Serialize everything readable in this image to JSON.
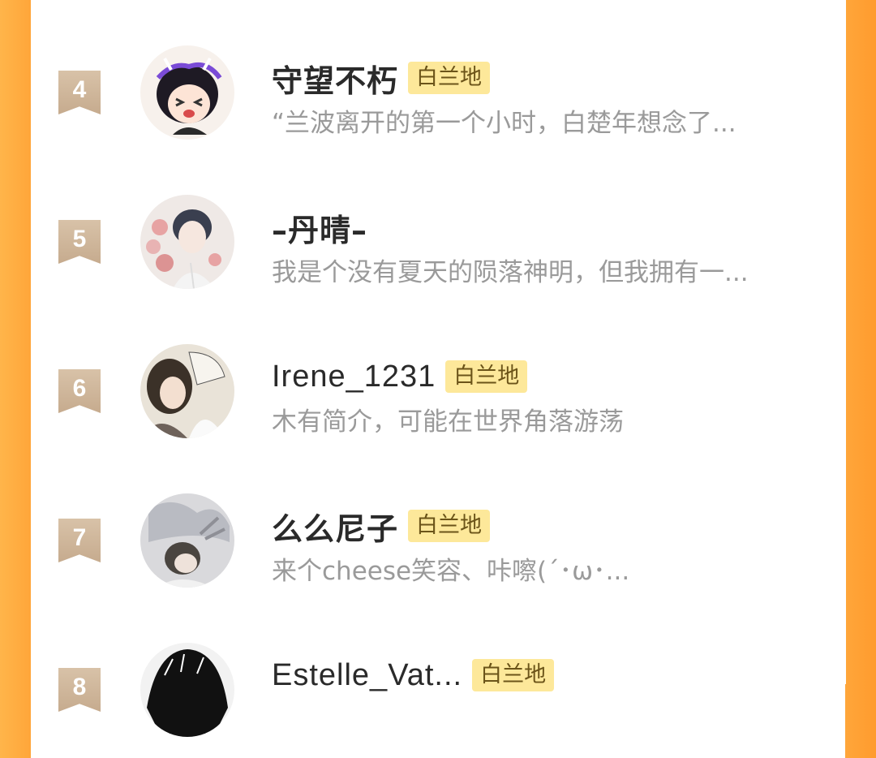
{
  "ranking_list": {
    "items": [
      {
        "rank": "4",
        "name": "守望不朽",
        "badge": "白兰地",
        "description": "“兰波离开的第一个小时，白楚年想念了...",
        "avatar_icon": "avatar-anime-boy-crying-icon"
      },
      {
        "rank": "5",
        "name": "–丹晴–",
        "badge": "",
        "description": "我是个没有夏天的陨落神明，但我拥有一...",
        "avatar_icon": "avatar-anime-man-flowers-icon"
      },
      {
        "rank": "6",
        "name": "Irene_1231",
        "badge": "白兰地",
        "description": "木有简介，可能在世界角落游荡",
        "avatar_icon": "avatar-anime-fan-couple-icon"
      },
      {
        "rank": "7",
        "name": "么么尼子",
        "badge": "白兰地",
        "description": "来个cheese笑容、咔嚓(´･ω･...",
        "avatar_icon": "avatar-anime-grey-couple-icon"
      },
      {
        "rank": "8",
        "name": "Estelle_Vat...",
        "badge": "白兰地",
        "description": "",
        "avatar_icon": "avatar-anime-dark-hair-icon"
      }
    ]
  },
  "colors": {
    "side_gradient": "#ffa63a",
    "rank_bookmark": "#c6ab8e",
    "badge_bg": "#fde89a",
    "name_text": "#2a2a2a",
    "desc_text": "#9a9a9a"
  }
}
